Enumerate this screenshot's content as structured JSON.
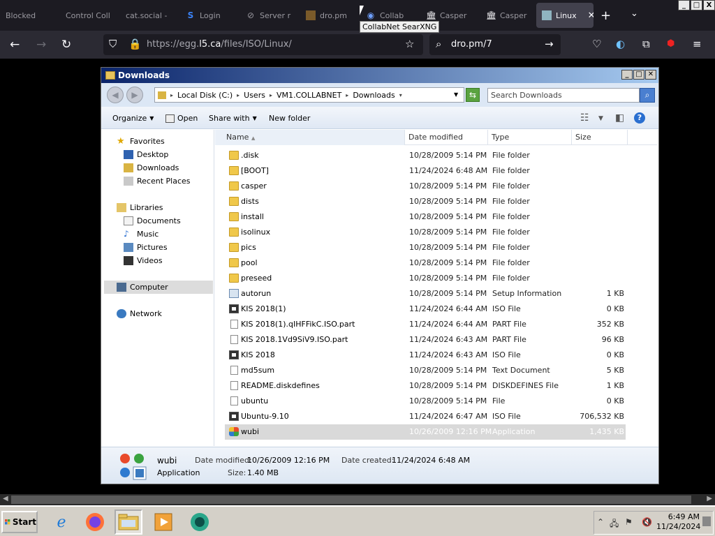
{
  "browser": {
    "tabs": [
      {
        "label": "Blocked",
        "icon": "blocked-icon"
      },
      {
        "label": "Control Coll",
        "icon": "page-icon"
      },
      {
        "label": "cat.social -",
        "icon": "page-icon"
      },
      {
        "label": "Login",
        "icon": "s-logo-icon"
      },
      {
        "label": "Server r",
        "icon": "server-icon"
      },
      {
        "label": "dro.pm",
        "icon": "dropm-icon"
      },
      {
        "label": "Collab",
        "icon": "collab-icon"
      },
      {
        "label": "Casper",
        "icon": "bank-icon"
      },
      {
        "label": "Casper",
        "icon": "bank-icon"
      },
      {
        "label": "Linux",
        "icon": "file-icon"
      }
    ],
    "tooltip": "CollabNet SearXNG",
    "url_prefix": "https://egg.",
    "url_domain": "l5.ca",
    "url_path": "/files/ISO/Linux/",
    "search_value": "dro.pm/7",
    "window_caps": [
      "_",
      "□",
      "X"
    ]
  },
  "explorer": {
    "title": "Downloads",
    "breadcrumb": [
      "Local Disk (C:)",
      "Users",
      "VM1.COLLABNET",
      "Downloads"
    ],
    "search_placeholder": "Search Downloads",
    "commands": {
      "organize": "Organize",
      "open": "Open",
      "share_with": "Share with",
      "new_folder": "New folder"
    },
    "nav": {
      "favorites": "Favorites",
      "desktop": "Desktop",
      "downloads": "Downloads",
      "recent_places": "Recent Places",
      "libraries": "Libraries",
      "documents": "Documents",
      "music": "Music",
      "pictures": "Pictures",
      "videos": "Videos",
      "computer": "Computer",
      "network": "Network"
    },
    "columns": {
      "name": "Name",
      "date": "Date modified",
      "type": "Type",
      "size": "Size"
    },
    "files": [
      {
        "name": ".disk",
        "date": "10/28/2009 5:14 PM",
        "type": "File folder",
        "size": "",
        "kind": "folder"
      },
      {
        "name": "[BOOT]",
        "date": "11/24/2024 6:48 AM",
        "type": "File folder",
        "size": "",
        "kind": "folder"
      },
      {
        "name": "casper",
        "date": "10/28/2009 5:14 PM",
        "type": "File folder",
        "size": "",
        "kind": "folder"
      },
      {
        "name": "dists",
        "date": "10/28/2009 5:14 PM",
        "type": "File folder",
        "size": "",
        "kind": "folder"
      },
      {
        "name": "install",
        "date": "10/28/2009 5:14 PM",
        "type": "File folder",
        "size": "",
        "kind": "folder"
      },
      {
        "name": "isolinux",
        "date": "10/28/2009 5:14 PM",
        "type": "File folder",
        "size": "",
        "kind": "folder"
      },
      {
        "name": "pics",
        "date": "10/28/2009 5:14 PM",
        "type": "File folder",
        "size": "",
        "kind": "folder"
      },
      {
        "name": "pool",
        "date": "10/28/2009 5:14 PM",
        "type": "File folder",
        "size": "",
        "kind": "folder"
      },
      {
        "name": "preseed",
        "date": "10/28/2009 5:14 PM",
        "type": "File folder",
        "size": "",
        "kind": "folder"
      },
      {
        "name": "autorun",
        "date": "10/28/2009 5:14 PM",
        "type": "Setup Information",
        "size": "1 KB",
        "kind": "setup"
      },
      {
        "name": "KIS 2018(1)",
        "date": "11/24/2024 6:44 AM",
        "type": "ISO File",
        "size": "0 KB",
        "kind": "iso"
      },
      {
        "name": "KIS 2018(1).qIHFFikC.ISO.part",
        "date": "11/24/2024 6:44 AM",
        "type": "PART File",
        "size": "352 KB",
        "kind": "doc"
      },
      {
        "name": "KIS 2018.1Vd9SiV9.ISO.part",
        "date": "11/24/2024 6:43 AM",
        "type": "PART File",
        "size": "96 KB",
        "kind": "doc"
      },
      {
        "name": "KIS 2018",
        "date": "11/24/2024 6:43 AM",
        "type": "ISO File",
        "size": "0 KB",
        "kind": "iso"
      },
      {
        "name": "md5sum",
        "date": "10/28/2009 5:14 PM",
        "type": "Text Document",
        "size": "5 KB",
        "kind": "doc"
      },
      {
        "name": "README.diskdefines",
        "date": "10/28/2009 5:14 PM",
        "type": "DISKDEFINES File",
        "size": "1 KB",
        "kind": "doc"
      },
      {
        "name": "ubuntu",
        "date": "10/28/2009 5:14 PM",
        "type": "File",
        "size": "0 KB",
        "kind": "doc"
      },
      {
        "name": "Ubuntu-9.10",
        "date": "11/24/2024 6:47 AM",
        "type": "ISO File",
        "size": "706,532 KB",
        "kind": "iso"
      },
      {
        "name": "wubi",
        "date": "10/26/2009 12:16 PM",
        "type": "Application",
        "size": "1,435 KB",
        "kind": "wubi"
      }
    ],
    "selected_index": 18,
    "details": {
      "name": "wubi",
      "type": "Application",
      "date_modified_label": "Date modified:",
      "date_modified": "10/26/2009 12:16 PM",
      "date_created_label": "Date created:",
      "date_created": "11/24/2024 6:48 AM",
      "size_label": "Size:",
      "size": "1.40 MB"
    }
  },
  "taskbar": {
    "start_label": "Start",
    "clock_time": "6:49 AM",
    "clock_date": "11/24/2024"
  }
}
